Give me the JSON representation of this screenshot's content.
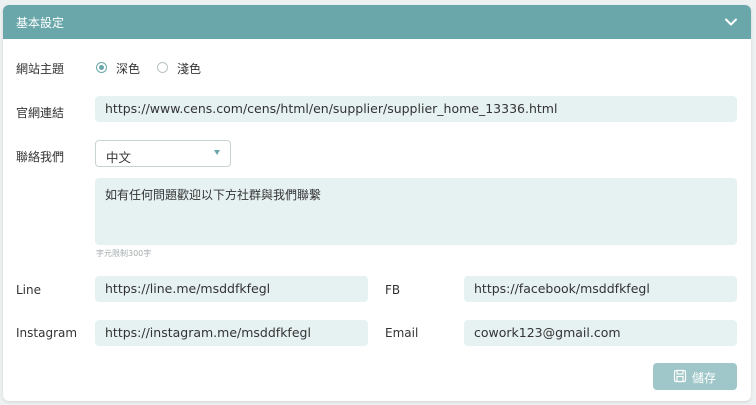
{
  "header": {
    "title": "基本設定",
    "toggle_icon": "chevron-down-icon"
  },
  "theme": {
    "label": "網站主題",
    "options": [
      {
        "label": "深色",
        "selected": true
      },
      {
        "label": "淺色",
        "selected": false
      }
    ]
  },
  "website": {
    "label": "官網連結",
    "value": "https://www.cens.com/cens/html/en/supplier/supplier_home_13336.html"
  },
  "contact": {
    "label": "聯絡我們",
    "language": "中文",
    "message": "如有任何問題歡迎以下方社群與我們聯繫",
    "char_limit_hint": "字元限制300字"
  },
  "social": {
    "line": {
      "label": "Line",
      "value": "https://line.me/msddfkfegl"
    },
    "fb": {
      "label": "FB",
      "value": "https://facebook/msddfkfegl"
    },
    "instagram": {
      "label": "Instagram",
      "value": "https://instagram.me/msddfkfegl"
    },
    "email": {
      "label": "Email",
      "value": "cowork123@gmail.com"
    }
  },
  "save_button": {
    "label": "儲存",
    "icon": "save-icon"
  },
  "colors": {
    "accent": "#6aa7aa",
    "field_bg": "#e6f1f1",
    "button": "#9fc7c9"
  }
}
